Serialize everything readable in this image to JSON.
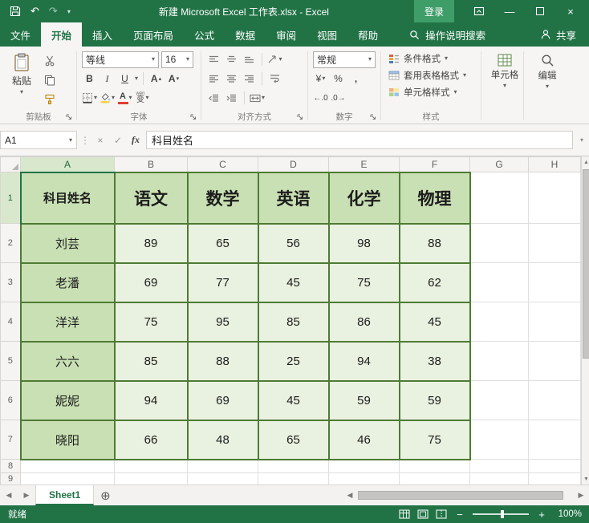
{
  "title_bar": {
    "title": "新建 Microsoft Excel 工作表.xlsx - Excel",
    "sign_in_label": "登录"
  },
  "ribbon": {
    "tabs": [
      "文件",
      "开始",
      "插入",
      "页面布局",
      "公式",
      "数据",
      "审阅",
      "视图",
      "帮助"
    ],
    "active_tab": "开始",
    "search_label": "操作说明搜索",
    "share_label": "共享",
    "clipboard": {
      "group_label": "剪贴板",
      "paste_label": "粘贴"
    },
    "font": {
      "group_label": "字体",
      "font_name": "等线",
      "font_size": "16",
      "bold": "B",
      "italic": "I",
      "underline": "U",
      "grow_font": "A",
      "shrink_font": "A",
      "font_color_letter": "A",
      "phonetic": "变",
      "phonetic_ruby": "wén"
    },
    "alignment": {
      "group_label": "对齐方式"
    },
    "number": {
      "group_label": "数字",
      "format": "常规",
      "currency": "¥",
      "percent": "%",
      "comma": ",",
      "inc_decimal": "←.0",
      "dec_decimal": ".0→"
    },
    "styles": {
      "group_label": "样式",
      "items": [
        "条件格式",
        "套用表格格式",
        "单元格样式"
      ]
    },
    "cells_label": "单元格",
    "editing_label": "编辑"
  },
  "formula_bar": {
    "name_box": "A1",
    "cancel": "×",
    "enter": "✓",
    "fx": "fx",
    "formula_text": "科目姓名"
  },
  "grid": {
    "columns": [
      "A",
      "B",
      "C",
      "D",
      "E",
      "F",
      "G",
      "H"
    ],
    "row_numbers": [
      "1",
      "2",
      "3",
      "4",
      "5",
      "6",
      "7",
      "8",
      "9"
    ],
    "table": {
      "header": [
        "科目姓名",
        "语文",
        "数学",
        "英语",
        "化学",
        "物理"
      ],
      "rows": [
        {
          "name": "刘芸",
          "values": [
            "89",
            "65",
            "56",
            "98",
            "88"
          ]
        },
        {
          "name": "老潘",
          "values": [
            "69",
            "77",
            "45",
            "75",
            "62"
          ]
        },
        {
          "name": "洋洋",
          "values": [
            "75",
            "95",
            "85",
            "86",
            "45"
          ]
        },
        {
          "name": "六六",
          "values": [
            "85",
            "88",
            "25",
            "94",
            "38"
          ]
        },
        {
          "name": "妮妮",
          "values": [
            "94",
            "69",
            "45",
            "59",
            "59"
          ]
        },
        {
          "name": "晓阳",
          "values": [
            "66",
            "48",
            "65",
            "46",
            "75"
          ]
        }
      ]
    }
  },
  "sheet_bar": {
    "active_sheet": "Sheet1"
  },
  "status_bar": {
    "status": "就绪",
    "zoom": "100%"
  },
  "colors": {
    "excel_green": "#217346",
    "table_border": "#4f7b35",
    "table_header_fill": "#c9e0b4",
    "table_data_fill": "#e9f2e0"
  },
  "icons": {
    "caret_down": "▾",
    "caret_up": "▴",
    "undo": "↶",
    "redo": "↷",
    "close": "×",
    "minimize": "—",
    "vdots": "⋮",
    "left": "◀",
    "right": "▶",
    "up": "▲",
    "down": "▼",
    "plus": "+",
    "minus": "−",
    "new_sheet": "⊕"
  }
}
